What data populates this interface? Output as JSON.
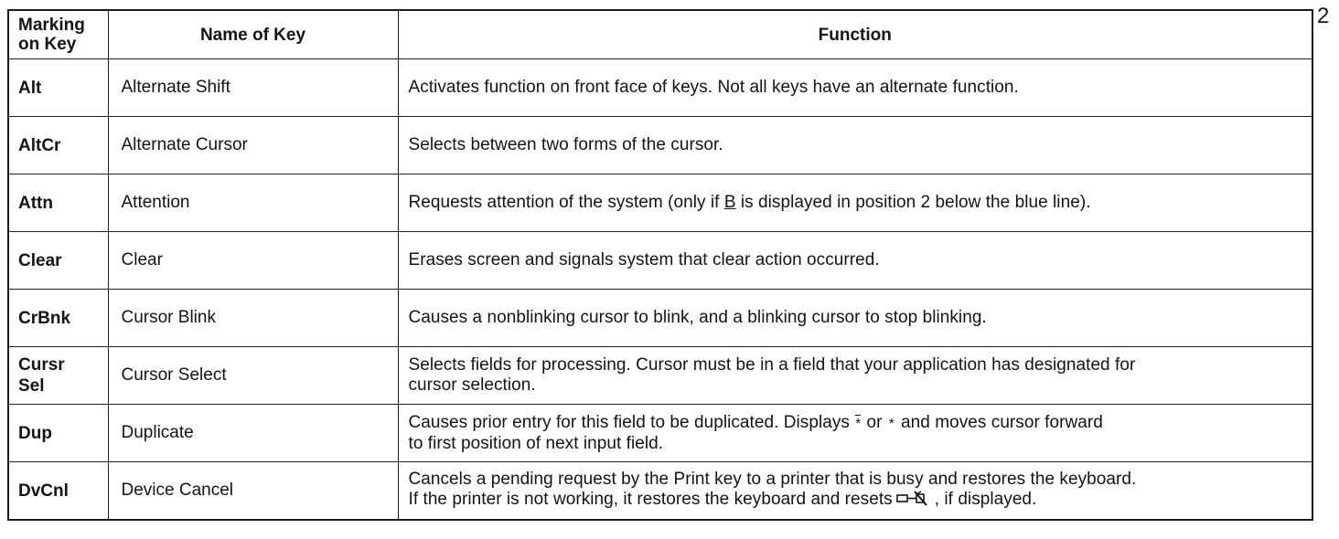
{
  "page": {
    "page_number": "2"
  },
  "table": {
    "headers": {
      "marking_line1": "Marking",
      "marking_line2": "on Key",
      "name": "Name of Key",
      "function": "Function"
    },
    "rows": [
      {
        "marking": [
          "Alt"
        ],
        "name": "Alternate Shift",
        "function": [
          "Activates function on front face of keys.  Not all keys have an alternate function."
        ]
      },
      {
        "marking": [
          "AltCr"
        ],
        "name": "Alternate Cursor",
        "function": [
          "Selects between two forms of the cursor."
        ]
      },
      {
        "marking": [
          "Attn"
        ],
        "name": "Attention",
        "function_parts": {
          "before": "Requests attention of the system (only if ",
          "underlined": "B",
          "after": " is displayed in position 2 below the blue line)."
        }
      },
      {
        "marking": [
          "Clear"
        ],
        "name": "Clear",
        "function": [
          "Erases screen and signals system that clear action occurred."
        ]
      },
      {
        "marking": [
          "CrBnk"
        ],
        "name": "Cursor Blink",
        "function": [
          "Causes a nonblinking cursor to blink, and a blinking cursor to stop blinking."
        ]
      },
      {
        "marking": [
          "Cursr",
          "Sel"
        ],
        "name": "Cursor Select",
        "function": [
          "Selects fields for processing.  Cursor must be in a field that your application has designated for",
          "cursor selection."
        ]
      },
      {
        "marking": [
          "Dup"
        ],
        "name": "Duplicate",
        "function_parts": {
          "line1_before": "Causes prior entry for this field to be duplicated.  Displays ",
          "overlined_star": "*",
          "line1_mid": " or ",
          "star": "*",
          "line1_after": " and moves cursor forward",
          "line2": "to first position of next input field."
        }
      },
      {
        "marking": [
          "DvCnl"
        ],
        "name": "Device Cancel",
        "function_parts": {
          "line1": "Cancels a pending request by the Print key to a printer that is busy and restores the keyboard.",
          "line2_before": "If the printer is not working, it restores the keyboard and resets",
          "icon": "printer-busy-indicator-icon",
          "line2_after": ", if displayed."
        }
      }
    ]
  }
}
